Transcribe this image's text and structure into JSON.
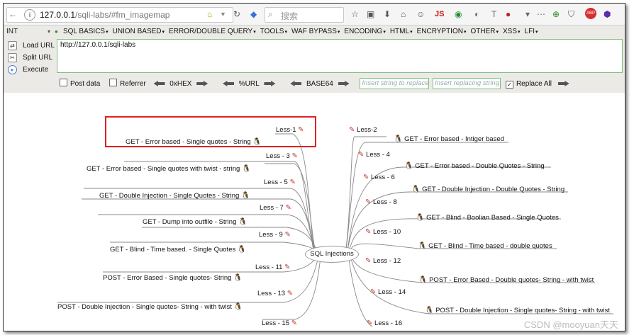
{
  "browser": {
    "url_host": "127.0.0.1",
    "url_path": "/sqli-labs/#fm_imagemap",
    "search_placeholder": "搜索",
    "icon_home": "home-icon",
    "addon_js": "JS"
  },
  "hackbar": {
    "select_value": "INT",
    "menus": [
      "SQL BASICS",
      "UNION BASED",
      "ERROR/DOUBLE QUERY",
      "TOOLS",
      "WAF BYPASS",
      "ENCODING",
      "HTML",
      "ENCRYPTION",
      "OTHER",
      "XSS",
      "LFI"
    ],
    "load_url": "Load URL",
    "split_url": "Split URL",
    "execute": "Execute",
    "textarea_value": "http://127.0.0.1/sqli-labs",
    "post_data": "Post data",
    "referrer": "Referrer",
    "hex": "0xHEX",
    "url_enc": "%URL",
    "base64": "BASE64",
    "insert_placeholder": "Insert string to replace",
    "replacing_placeholder": "Insert replacing string",
    "replace_all": "Replace All"
  },
  "mindmap": {
    "center": "SQL Injections",
    "left": [
      {
        "less": "Less-1",
        "title": "GET - Error based - Single quotes - String"
      },
      {
        "less": "Less - 3",
        "title": "GET - Error based - Single quotes with twist - string"
      },
      {
        "less": "Less - 5",
        "title": "GET - Double Injection - Single Quotes - String"
      },
      {
        "less": "Less - 7",
        "title": "GET - Dump into outfile - String"
      },
      {
        "less": "Less - 9",
        "title": "GET - Blind - Time based. -  Single Quotes"
      },
      {
        "less": "Less - 11",
        "title": "POST - Error Based - Single quotes- String"
      },
      {
        "less": "Less - 13",
        "title": "POST - Double Injection - Single quotes- String - with twist"
      },
      {
        "less": "Less - 15",
        "title": ""
      }
    ],
    "right": [
      {
        "less": "Less-2",
        "title": "GET - Error based - Intiger based"
      },
      {
        "less": "Less - 4",
        "title": "GET - Error based - Double Quotes - String"
      },
      {
        "less": "Less - 6",
        "title": "GET - Double Injection - Double Quotes - String"
      },
      {
        "less": "Less - 8",
        "title": "GET - Blind - Boolian Based - Single Quotes"
      },
      {
        "less": "Less - 10",
        "title": "GET - Blind - Time based - double quotes"
      },
      {
        "less": "Less - 12",
        "title": "POST - Error Based - Double quotes- String - with twist"
      },
      {
        "less": "Less - 14",
        "title": "POST - Double Injection - Single quotes- String - with twist"
      },
      {
        "less": "Less - 16",
        "title": ""
      }
    ]
  },
  "watermark": "CSDN @mooyuan天天",
  "colors": {
    "highlight": "#e02020",
    "textarea_border": "#7fbf7f"
  }
}
